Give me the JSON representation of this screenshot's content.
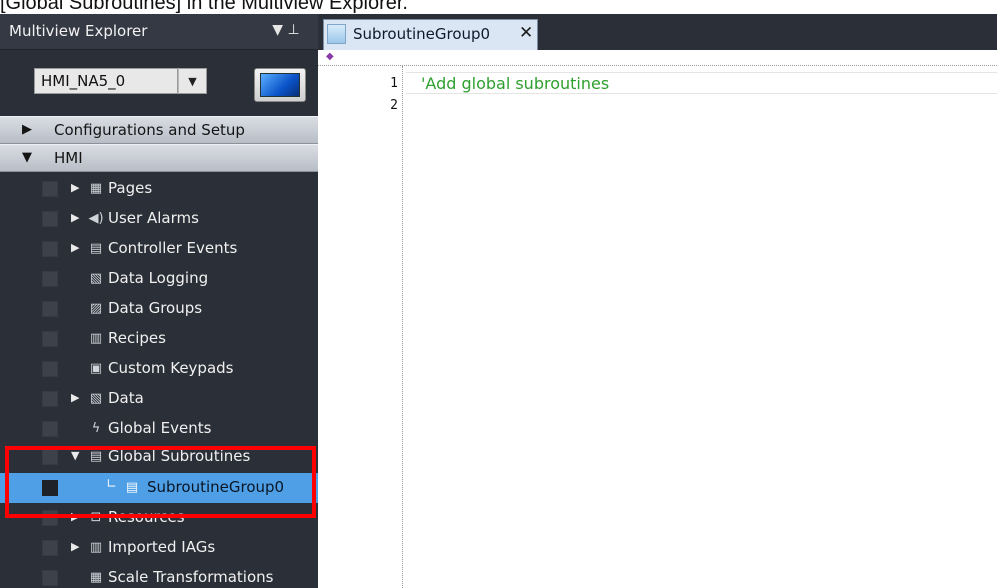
{
  "caption": "[Global Subroutines] in the Multiview Explorer.",
  "explorer": {
    "title": "Multiview Explorer",
    "pin_glyphs": "▼ ⊥",
    "device_selector": {
      "value": "HMI_NA5_0",
      "drop_glyph": "▼"
    },
    "sections": {
      "config": {
        "label": "Configurations and Setup",
        "arrow": "▶"
      },
      "hmi": {
        "label": "HMI",
        "arrow": "▼"
      }
    },
    "items": [
      {
        "label": "Pages",
        "arrow": "▶",
        "icon": "pages-icon",
        "glyph": "▦"
      },
      {
        "label": "User Alarms",
        "arrow": "▶",
        "icon": "speaker-icon",
        "glyph": "◀)"
      },
      {
        "label": "Controller Events",
        "arrow": "▶",
        "icon": "controller-events-icon",
        "glyph": "▤"
      },
      {
        "label": "Data Logging",
        "arrow": "",
        "icon": "data-logging-icon",
        "glyph": "▧"
      },
      {
        "label": "Data Groups",
        "arrow": "",
        "icon": "data-groups-icon",
        "glyph": "▨"
      },
      {
        "label": "Recipes",
        "arrow": "",
        "icon": "recipes-icon",
        "glyph": "▥"
      },
      {
        "label": "Custom Keypads",
        "arrow": "",
        "icon": "keypad-icon",
        "glyph": "▣"
      },
      {
        "label": "Data",
        "arrow": "▶",
        "icon": "data-icon",
        "glyph": "▧"
      },
      {
        "label": "Global Events",
        "arrow": "",
        "icon": "lightning-icon",
        "glyph": "ϟ"
      },
      {
        "label": "Global Subroutines",
        "arrow": "▼",
        "icon": "subroutines-icon",
        "glyph": "▤"
      },
      {
        "label": "SubroutineGroup0",
        "arrow": "",
        "icon": "subroutine-file-icon",
        "glyph": "▤",
        "elbow": "∟",
        "selected": true
      },
      {
        "label": "Resources",
        "arrow": "▶",
        "icon": "resources-icon",
        "glyph": "⊡"
      },
      {
        "label": "Imported IAGs",
        "arrow": "▶",
        "icon": "iag-icon",
        "glyph": "▥"
      },
      {
        "label": "Scale Transformations",
        "arrow": "",
        "icon": "scale-icon",
        "glyph": "▦"
      }
    ]
  },
  "editor": {
    "tab": {
      "label": "SubroutineGroup0",
      "close": "✕"
    },
    "marker_glyph": "◆",
    "lines": [
      {
        "number": "1",
        "text": "'Add global subroutines"
      },
      {
        "number": "2",
        "text": ""
      }
    ]
  },
  "colors": {
    "panel_bg": "#2b2f37",
    "selected_bg": "#4f9fe6",
    "highlight": "#ff0000",
    "comment_green": "#2ea02e"
  }
}
